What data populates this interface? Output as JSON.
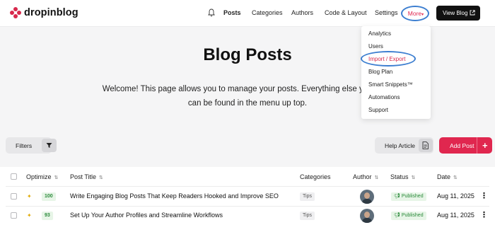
{
  "header": {
    "logo_text": "dropinblog",
    "nav": [
      "Posts",
      "Categories",
      "Authors",
      "Code & Layout",
      "Settings"
    ],
    "more_label": "More",
    "view_blog_label": "View Blog"
  },
  "dropdown": {
    "items": [
      "Analytics",
      "Users",
      "Import / Export",
      "Blog Plan",
      "Smart Snippets™",
      "Automations",
      "Support"
    ]
  },
  "page": {
    "title": "Blog Posts",
    "welcome": "Welcome! This page allows you to manage your posts. Everything else you need can be found in the menu up top."
  },
  "toolbar": {
    "filters_label": "Filters",
    "help_label": "Help Article",
    "add_post_label": "Add Post",
    "add_post_plus": "+"
  },
  "table": {
    "columns": [
      "Optimize",
      "Post Title",
      "Categories",
      "Author",
      "Status",
      "Date"
    ],
    "rows": [
      {
        "score": "100",
        "title": "Write Engaging Blog Posts That Keep Readers Hooked and Improve SEO",
        "category": "Tips",
        "status": "Published",
        "date": "Aug 11, 2025"
      },
      {
        "score": "93",
        "title": "Set Up Your Author Profiles and Streamline Workflows",
        "category": "Tips",
        "status": "Published",
        "date": "Aug 11, 2025"
      }
    ]
  },
  "colors": {
    "accent": "#e0274f",
    "highlight_ring": "#3c7ed0",
    "published": "#2a8a3a"
  }
}
